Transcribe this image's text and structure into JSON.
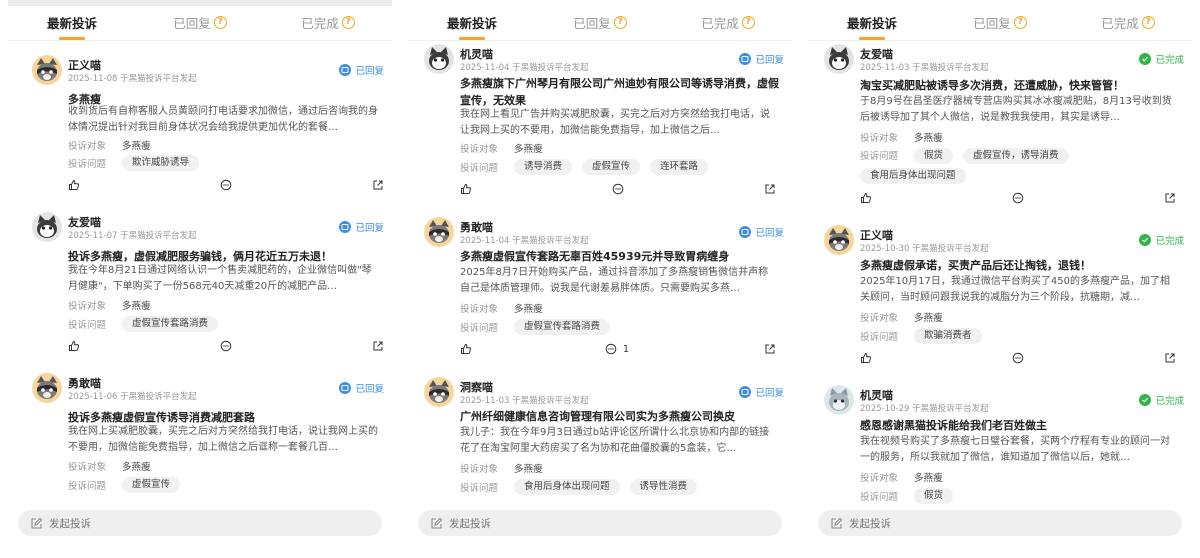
{
  "tabs": {
    "latest": "最新投诉",
    "replied": "已回复",
    "completed": "已完成"
  },
  "labels": {
    "target": "投诉对象",
    "issue": "投诉问题",
    "post": "发起投诉"
  },
  "colors": {
    "accent": "#f5a623",
    "replied": "#3a8ee6",
    "done": "#2fb44a"
  },
  "panels": [
    {
      "cards": [
        {
          "avatar": "raccoon-avatar-icon",
          "user": "正义喵",
          "meta": "2025-11-08 于黑猫投诉平台发起",
          "status": "已回复",
          "status_type": "replied",
          "title": "多燕瘦",
          "body": "收到货后有自称客服人员黄颐问打电话要求加微信，通过后咨询我的身体情况提出针对我目前身体状况会给我提供更加优化的套餐…",
          "target": "多燕瘦",
          "issues": [
            "欺诈威胁诱导"
          ],
          "comments": ""
        },
        {
          "avatar": "cat-avatar-icon",
          "user": "友爱喵",
          "meta": "2025-11-07 于黑猫投诉平台发起",
          "status": "已回复",
          "status_type": "replied",
          "title": "投诉多燕瘦，虚假减肥服务骗钱，俩月花近五万未退！",
          "body": "我在今年8月21日通过网络认识一个售卖减肥药的，企业微信叫做\"琴月健康\"，下单购买了一份568元40天减重20斤的减肥产品…",
          "target": "多燕瘦",
          "issues": [
            "虚假宣传套路消费"
          ],
          "comments": ""
        },
        {
          "avatar": "raccoon-avatar-icon",
          "user": "勇敢喵",
          "meta": "2025-11-06 于黑猫投诉平台发起",
          "status": "已回复",
          "status_type": "replied",
          "title": "投诉多燕瘦虚假宣传诱导消费减肥套路",
          "body": "我在网上买减肥胶囊，买完之后对方突然给我打电话，说让我网上买的不要用，加微信能免费指导，加上微信之后诓称一套餐几百…",
          "target": "多燕瘦",
          "issues": [
            "虚假宣传"
          ],
          "comments": ""
        }
      ]
    },
    {
      "cards": [
        {
          "avatar": "cat-avatar-icon",
          "user": "机灵喵",
          "meta": "2025-11-04 于黑猫投诉平台发起",
          "status": "已回复",
          "status_type": "replied",
          "title": "多燕瘦旗下广州琴月有限公司广州迪妙有限公司等诱导消费，虚假宣传，无效果",
          "body": "我在网上看见广告并购买减肥胶囊，买完之后对方突然给我打电话，说让我网上买的不要用，加微信能免费指导，加上微信之后…",
          "target": "多燕瘦",
          "issues": [
            "诱导消费",
            "虚假宣传",
            "连环套路"
          ],
          "comments": ""
        },
        {
          "avatar": "raccoon-avatar-icon",
          "user": "勇敢喵",
          "meta": "2025-11-04 于黑猫投诉平台发起",
          "status": "已回复",
          "status_type": "replied",
          "title": "多燕瘦虚假宣传套路无辜百姓45939元并导致胃病缠身",
          "body": "2025年8月7日开始购买产品，通过抖音添加了多燕瘦销售微信并声称自己是体质管理师。说我是代谢差易胖体质。只需要购买多燕…",
          "target": "多燕瘦",
          "issues": [
            "虚假宣传套路消费"
          ],
          "comments": "1"
        },
        {
          "avatar": "raccoon-avatar-icon",
          "user": "洞察喵",
          "meta": "2025-11-03 于黑猫投诉平台发起",
          "status": "已回复",
          "status_type": "replied",
          "title": "广州纤细健康信息咨询管理有限公司实为多燕瘦公司换皮",
          "body": "我儿子：我在今年9月3日通过b站评论区所谓什么北京协和内部的链接花了在淘宝阿里大药房买了名为协和花曲僵胶囊的5盒装，它…",
          "target": "多燕瘦",
          "issues": [
            "食用后身体出现问题",
            "诱导性消费"
          ],
          "comments": ""
        }
      ]
    },
    {
      "cards": [
        {
          "avatar": "cat-avatar-icon",
          "user": "友爱喵",
          "meta": "2025-11-03 于黑猫投诉平台发起",
          "status": "已完成",
          "status_type": "done",
          "title": "淘宝买减肥贴被诱导多次消费，还遭威胁，快来管管！",
          "body": "于8月9号在昌圣医疗器械专营店购买其冰冰瘦减肥贴，8月13号收到货后被诱导加了其个人微信，说是教我我使用，其实是诱导…",
          "target": "多燕瘦",
          "issues": [
            "假货",
            "虚假宣传，诱导消费",
            "食用后身体出现问题"
          ],
          "comments": ""
        },
        {
          "avatar": "raccoon-avatar-icon",
          "user": "正义喵",
          "meta": "2025-10-30 于黑猫投诉平台发起",
          "status": "已完成",
          "status_type": "done",
          "title": "多燕瘦虚假承诺，买责产品后还让掏钱，退钱！",
          "body": "2025年10月17日，我通过微信平台购买了450的多燕瘦产品，加了相关顾问，当时顾问跟我说我的减脂分为三个阶段，抗糖期，减…",
          "target": "多燕瘦",
          "issues": [
            "欺骗消费者"
          ],
          "comments": ""
        },
        {
          "avatar": "cat-avatar-icon",
          "user": "机灵喵",
          "meta": "2025-10-29 于黑猫投诉平台发起",
          "status": "已完成",
          "status_type": "done",
          "title": "感恩感谢黑猫投诉能给我们老百姓做主",
          "body": "我在视频号购买了多燕瘦七日璧谷套餐，买两个疗程有专业的顾问一对一的服务，所以我就加了微信，谁知道加了微信以后，她就…",
          "target": "多燕瘦",
          "issues": [
            "假货"
          ],
          "comments": ""
        }
      ]
    }
  ]
}
